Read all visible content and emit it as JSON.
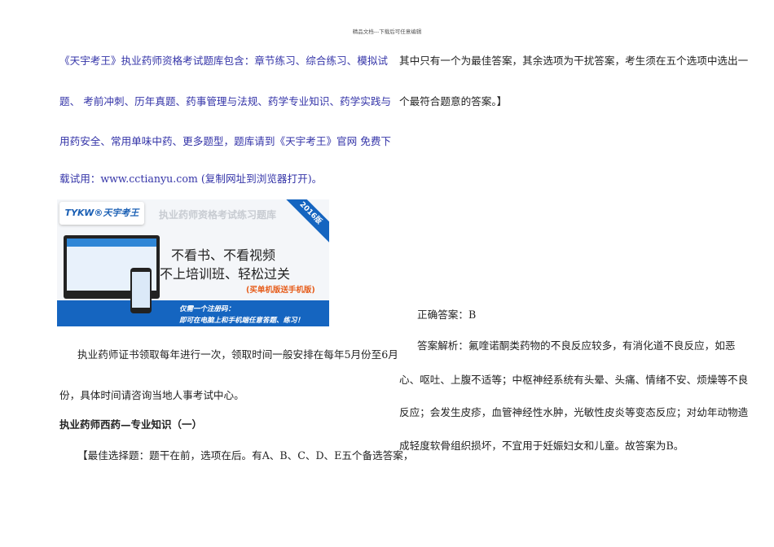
{
  "header": "精品文档---下载后可任意编辑",
  "left": {
    "intro_lines": [
      "《天宇考王》执业药师资格考试题库包含：章节练习、综合练习、模拟试",
      "题、 考前冲刺、历年真题、药事管理与法规、药学专业知识、药学实践与",
      "用药安全、常用单味中药、更多题型，题库请到《天宇考王》官网 免费下",
      "载试用：www.cctianyu.com (复制网址到浏览器打开)。"
    ],
    "banner": {
      "logo": "TYKW®天宇考王",
      "title": "执业药师资格考试练习题库",
      "corner": "2016版",
      "slogan1": "不看书、不看视频",
      "slogan2": "不上培训班、轻松过关",
      "promo": "(买单机版送手机版)",
      "bottom1": "仅需一个注册码：",
      "bottom2": "即可在电脑上和手机端任意答题、练习！"
    },
    "para_lines": [
      "执业药师证书领取每年进行一次，领取时间一般安排在每年5月份至6月",
      "份，具体时间请咨询当地人事考试中心。"
    ],
    "heading": "执业药师西药—专业知识（一）",
    "question_line": "【最佳选择题：题干在前，选项在后。有A、B、C、D、E五个备选答案，"
  },
  "right": {
    "question_lines": [
      "其中只有一个为最佳答案，其余选项为干扰答案，考生须在五个选项中选出一",
      "个最符合题意的答案。】"
    ],
    "answer": "正确答案：B",
    "analysis_lines": [
      "答案解析：氟喹诺酮类药物的不良反应较多，有消化道不良反应，如恶",
      "心、呕吐、上腹不适等；中枢神经系统有头晕、头痛、情绪不安、烦燥等不良",
      "反应；会发生皮疹，血管神经性水肿，光敏性皮炎等变态反应；对幼年动物造",
      "成轻度软骨组织损坏，不宜用于妊娠妇女和儿童。故答案为B。"
    ]
  }
}
